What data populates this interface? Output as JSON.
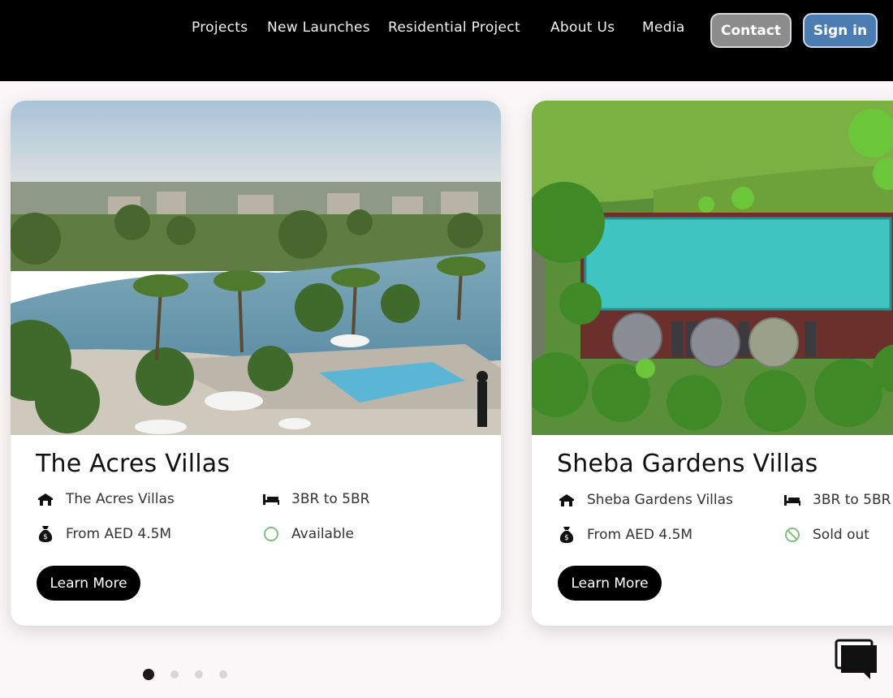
{
  "nav": {
    "links": [
      "Projects",
      "New Launches",
      "Residential Project",
      "About Us",
      "Media"
    ],
    "contact_label": "Contact",
    "signin_label": "Sign in"
  },
  "cards": [
    {
      "title": "The Acres Villas",
      "project": "The Acres Villas",
      "bedrooms": "3BR to 5BR",
      "price": "From AED 4.5M",
      "status": "Available",
      "button": "Learn More"
    },
    {
      "title": "Sheba Gardens Villas",
      "project": "Sheba Gardens Villas",
      "bedrooms": "3BR to 5BR",
      "price": "From AED 4.5M",
      "status": "Sold out",
      "button": "Learn More"
    }
  ],
  "carousel": {
    "total_pages": 4,
    "active_page": 1
  },
  "icons": {
    "project": "building-icon",
    "bedrooms": "bed-icon",
    "price": "money-bag-icon",
    "available": "circle-icon",
    "sold_out": "prohibited-icon",
    "chat": "chat-icon"
  },
  "colors": {
    "nav_bg": "#000000",
    "contact_bg": "#8c8c8c",
    "signin_bg": "#4b7db2",
    "status_icon": "#7fbf7f",
    "button_bg": "#000000"
  }
}
